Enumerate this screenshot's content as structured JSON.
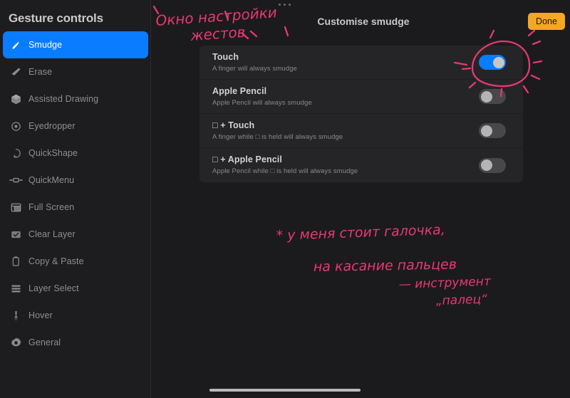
{
  "sidebar": {
    "title": "Gesture controls",
    "items": [
      {
        "label": "Smudge",
        "icon": "smudge-icon",
        "active": true
      },
      {
        "label": "Erase",
        "icon": "eraser-icon",
        "active": false
      },
      {
        "label": "Assisted Drawing",
        "icon": "cube-icon",
        "active": false
      },
      {
        "label": "Eyedropper",
        "icon": "eyedropper-icon",
        "active": false
      },
      {
        "label": "QuickShape",
        "icon": "quickshape-icon",
        "active": false
      },
      {
        "label": "QuickMenu",
        "icon": "quickmenu-icon",
        "active": false
      },
      {
        "label": "Full Screen",
        "icon": "fullscreen-icon",
        "active": false
      },
      {
        "label": "Clear Layer",
        "icon": "clear-layer-icon",
        "active": false
      },
      {
        "label": "Copy & Paste",
        "icon": "copy-paste-icon",
        "active": false
      },
      {
        "label": "Layer Select",
        "icon": "layer-select-icon",
        "active": false
      },
      {
        "label": "Hover",
        "icon": "stylus-hover-icon",
        "active": false
      },
      {
        "label": "General",
        "icon": "gear-icon",
        "active": false
      }
    ]
  },
  "header": {
    "title": "Customise smudge",
    "done_label": "Done",
    "drag_handle": "three-dots-handle"
  },
  "settings": {
    "rows": [
      {
        "title": "Touch",
        "subtitle": "A finger will always smudge",
        "toggle_on": true
      },
      {
        "title": "Apple Pencil",
        "subtitle": "Apple Pencil will always smudge",
        "toggle_on": false
      },
      {
        "title": "□ + Touch",
        "subtitle": "A finger while □ is held will always smudge",
        "toggle_on": false
      },
      {
        "title": "□ + Apple Pencil",
        "subtitle": "Apple Pencil while □ is held will always smudge",
        "toggle_on": false
      }
    ]
  },
  "annotations": {
    "ink_color": "#e8396f",
    "top_note_line1": "Окно настройки",
    "top_note_line2": "жестов",
    "bottom_note_line1": "* у меня  стоит   галочка,",
    "bottom_note_line2": "на  касание  пальцев",
    "bottom_note_line3": "— инструмент",
    "bottom_note_line4": "„палец“"
  },
  "colors": {
    "accent_blue": "#0a7cff",
    "done_orange": "#f5a623",
    "background": "#1b1b1d",
    "panel": "#252527",
    "ink_pink": "#e8396f"
  },
  "system": {
    "home_indicator": "home-indicator-bar"
  }
}
